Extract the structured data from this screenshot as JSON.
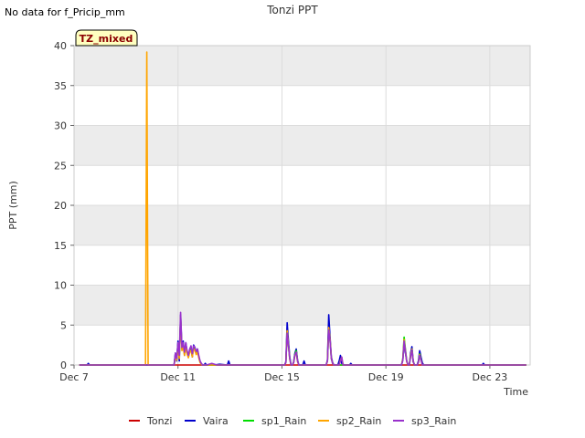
{
  "no_data_note": "No data for f_Pricip_mm",
  "badge": "TZ_mixed",
  "colors": {
    "band": "#ececec",
    "grid": "#dcdcdc",
    "badge_bg": "#ffffc0",
    "badge_text": "#8b0000"
  },
  "chart_data": {
    "type": "line",
    "title": "Tonzi PPT",
    "xlabel": "Time",
    "ylabel": "PPT (mm)",
    "ylim": [
      0,
      40
    ],
    "yticks": [
      0,
      5,
      10,
      15,
      20,
      25,
      30,
      35,
      40
    ],
    "xlim": [
      7.0,
      24.55
    ],
    "xticks": [
      {
        "v": 7,
        "label": "Dec 7"
      },
      {
        "v": 11,
        "label": "Dec 11"
      },
      {
        "v": 15,
        "label": "Dec 15"
      },
      {
        "v": 19,
        "label": "Dec 19"
      },
      {
        "v": 23,
        "label": "Dec 23"
      }
    ],
    "grid": true,
    "legend_position": "bottom",
    "series": [
      {
        "name": "Tonzi",
        "color": "#cc0000",
        "x": [
          7.2,
          24.4
        ],
        "y": [
          0,
          0
        ]
      },
      {
        "name": "Vaira",
        "color": "#0000cc",
        "x": [
          7.2,
          7.5,
          7.55,
          7.6,
          9.5,
          10.85,
          10.9,
          10.95,
          11.0,
          11.05,
          11.1,
          11.15,
          11.2,
          11.25,
          11.3,
          11.35,
          11.4,
          11.45,
          11.5,
          11.55,
          11.6,
          11.65,
          11.7,
          11.75,
          11.8,
          11.85,
          11.9,
          11.95,
          12.0,
          12.05,
          12.1,
          12.4,
          12.6,
          12.9,
          12.95,
          13.0,
          15.1,
          15.15,
          15.2,
          15.25,
          15.3,
          15.35,
          15.4,
          15.45,
          15.5,
          15.55,
          15.6,
          15.65,
          15.7,
          15.8,
          15.85,
          15.9,
          16.6,
          16.7,
          16.75,
          16.8,
          16.85,
          16.9,
          16.95,
          17.0,
          17.15,
          17.2,
          17.25,
          17.3,
          17.4,
          17.6,
          17.65,
          17.7,
          19.6,
          19.65,
          19.7,
          19.75,
          19.8,
          19.85,
          19.9,
          19.95,
          20.0,
          20.05,
          20.1,
          20.15,
          20.2,
          20.25,
          20.3,
          20.35,
          20.4,
          20.45,
          20.5,
          22.7,
          22.75,
          22.8,
          24.4
        ],
        "y": [
          0,
          0,
          0.2,
          0,
          0,
          0,
          1.5,
          0.5,
          3.0,
          0.5,
          6.3,
          2.0,
          3.0,
          1.2,
          2.8,
          1.5,
          1.0,
          1.8,
          2.2,
          1.0,
          2.5,
          2.2,
          1.5,
          2.0,
          1.0,
          0.4,
          0.1,
          0,
          0,
          0.2,
          0,
          0,
          0.1,
          0,
          0.5,
          0,
          0,
          0.4,
          5.3,
          3.0,
          1.0,
          0,
          0,
          0.4,
          1.5,
          2.0,
          0.6,
          0,
          0,
          0,
          0.5,
          0,
          0,
          0,
          0.6,
          6.3,
          3.5,
          1.0,
          0.3,
          0,
          0,
          0.5,
          1.2,
          0.2,
          0,
          0,
          0.2,
          0,
          0,
          0.6,
          2.8,
          1.5,
          0.5,
          0,
          0,
          1.5,
          2.3,
          0.5,
          0,
          0,
          0,
          0.5,
          1.8,
          1.0,
          0.3,
          0,
          0,
          0,
          0.2,
          0,
          0
        ]
      },
      {
        "name": "sp1_Rain",
        "color": "#00dd00",
        "x": [
          7.2,
          10.85,
          10.9,
          10.95,
          11.0,
          11.05,
          11.1,
          11.15,
          11.2,
          11.25,
          11.3,
          11.35,
          11.4,
          11.45,
          11.5,
          11.55,
          11.6,
          11.65,
          11.7,
          11.75,
          11.8,
          11.85,
          11.9,
          11.95,
          12.0,
          15.1,
          15.15,
          15.2,
          15.25,
          15.3,
          15.35,
          15.4,
          15.45,
          15.5,
          15.55,
          15.6,
          15.65,
          16.7,
          16.75,
          16.8,
          16.85,
          16.9,
          16.95,
          17.0,
          19.6,
          19.65,
          19.7,
          19.75,
          19.8,
          19.85,
          19.9,
          19.95,
          20.0,
          20.05,
          20.1,
          20.15,
          20.2,
          20.25,
          20.3,
          20.35,
          20.4,
          24.4
        ],
        "y": [
          0,
          0,
          1.2,
          0.8,
          2.5,
          1.0,
          5.8,
          2.0,
          2.5,
          1.5,
          2.5,
          1.5,
          1.0,
          1.8,
          2.0,
          1.2,
          2.2,
          2.0,
          1.5,
          1.8,
          1.0,
          0.4,
          0.1,
          0,
          0,
          0,
          0.3,
          4.2,
          2.5,
          0.8,
          0,
          0,
          0.3,
          1.4,
          1.8,
          0.5,
          0,
          0,
          0.5,
          4.5,
          3.0,
          0.8,
          0.2,
          0,
          0,
          0.8,
          3.5,
          2.0,
          0.5,
          0,
          0,
          1.2,
          2.0,
          0.4,
          0,
          0,
          0,
          0.3,
          1.4,
          0.7,
          0,
          0
        ]
      },
      {
        "name": "sp2_Rain",
        "color": "#ffa500",
        "x": [
          7.2,
          9.75,
          9.8,
          9.85,
          10.85,
          10.9,
          10.95,
          11.0,
          11.05,
          11.1,
          11.15,
          11.2,
          11.25,
          11.3,
          11.35,
          11.4,
          11.45,
          11.5,
          11.55,
          11.6,
          11.65,
          11.7,
          11.75,
          11.8,
          11.85,
          11.9,
          11.95,
          12.0,
          15.1,
          15.15,
          15.2,
          15.25,
          15.3,
          15.35,
          15.4,
          15.45,
          15.5,
          15.55,
          15.6,
          15.65,
          16.7,
          16.75,
          16.8,
          16.85,
          16.9,
          16.95,
          17.0,
          17.2,
          17.25,
          17.3,
          17.35,
          19.6,
          19.65,
          19.7,
          19.75,
          19.8,
          19.85,
          19.9,
          19.95,
          20.0,
          20.05,
          20.1,
          20.15,
          20.2,
          20.25,
          20.3,
          20.35,
          20.4,
          24.4
        ],
        "y": [
          0,
          0,
          39.2,
          0,
          0,
          1.0,
          0.6,
          2.2,
          0.8,
          6.0,
          1.8,
          2.2,
          1.2,
          2.2,
          1.4,
          0.9,
          1.6,
          1.8,
          1.0,
          2.0,
          1.8,
          1.3,
          1.6,
          0.9,
          0.3,
          0.1,
          0,
          0,
          0,
          0.3,
          4.3,
          2.5,
          0.7,
          0,
          0,
          0.3,
          1.2,
          1.6,
          0.4,
          0,
          0,
          0.5,
          4.7,
          3.2,
          0.8,
          0.2,
          0,
          0,
          0.6,
          1.0,
          0,
          0,
          0.7,
          3.2,
          1.8,
          0.4,
          0,
          0,
          1.2,
          2.0,
          0.4,
          0,
          0,
          0,
          0.3,
          1.3,
          0.6,
          0,
          0
        ]
      },
      {
        "name": "sp3_Rain",
        "color": "#9932cc",
        "x": [
          7.2,
          10.85,
          10.9,
          10.95,
          11.0,
          11.05,
          11.1,
          11.15,
          11.2,
          11.25,
          11.3,
          11.35,
          11.4,
          11.45,
          11.5,
          11.55,
          11.6,
          11.65,
          11.7,
          11.75,
          11.8,
          11.85,
          11.9,
          11.95,
          12.0,
          12.1,
          12.3,
          12.4,
          12.5,
          15.1,
          15.15,
          15.2,
          15.25,
          15.3,
          15.35,
          15.4,
          15.45,
          15.5,
          15.55,
          15.6,
          15.65,
          16.7,
          16.75,
          16.8,
          16.85,
          16.9,
          16.95,
          17.0,
          17.2,
          17.25,
          17.3,
          17.35,
          19.6,
          19.65,
          19.7,
          19.75,
          19.8,
          19.85,
          19.9,
          19.95,
          20.0,
          20.05,
          20.1,
          20.15,
          20.2,
          20.25,
          20.3,
          20.35,
          20.4,
          24.4
        ],
        "y": [
          0,
          0,
          1.5,
          0.8,
          2.8,
          1.2,
          6.6,
          2.2,
          2.8,
          1.6,
          2.8,
          1.8,
          1.2,
          2.0,
          2.4,
          1.4,
          2.4,
          2.2,
          1.7,
          2.0,
          1.2,
          0.5,
          0.2,
          0,
          0,
          0,
          0.2,
          0.1,
          0,
          0,
          0.3,
          4.0,
          2.4,
          0.8,
          0,
          0,
          0.3,
          1.3,
          1.6,
          0.5,
          0,
          0,
          0.5,
          4.4,
          3.0,
          0.8,
          0.2,
          0,
          0,
          0.5,
          1.0,
          0,
          0,
          0.6,
          3.0,
          1.8,
          0.5,
          0,
          0,
          1.0,
          1.9,
          0.4,
          0,
          0,
          0,
          0.3,
          1.2,
          0.6,
          0,
          0
        ]
      }
    ]
  }
}
